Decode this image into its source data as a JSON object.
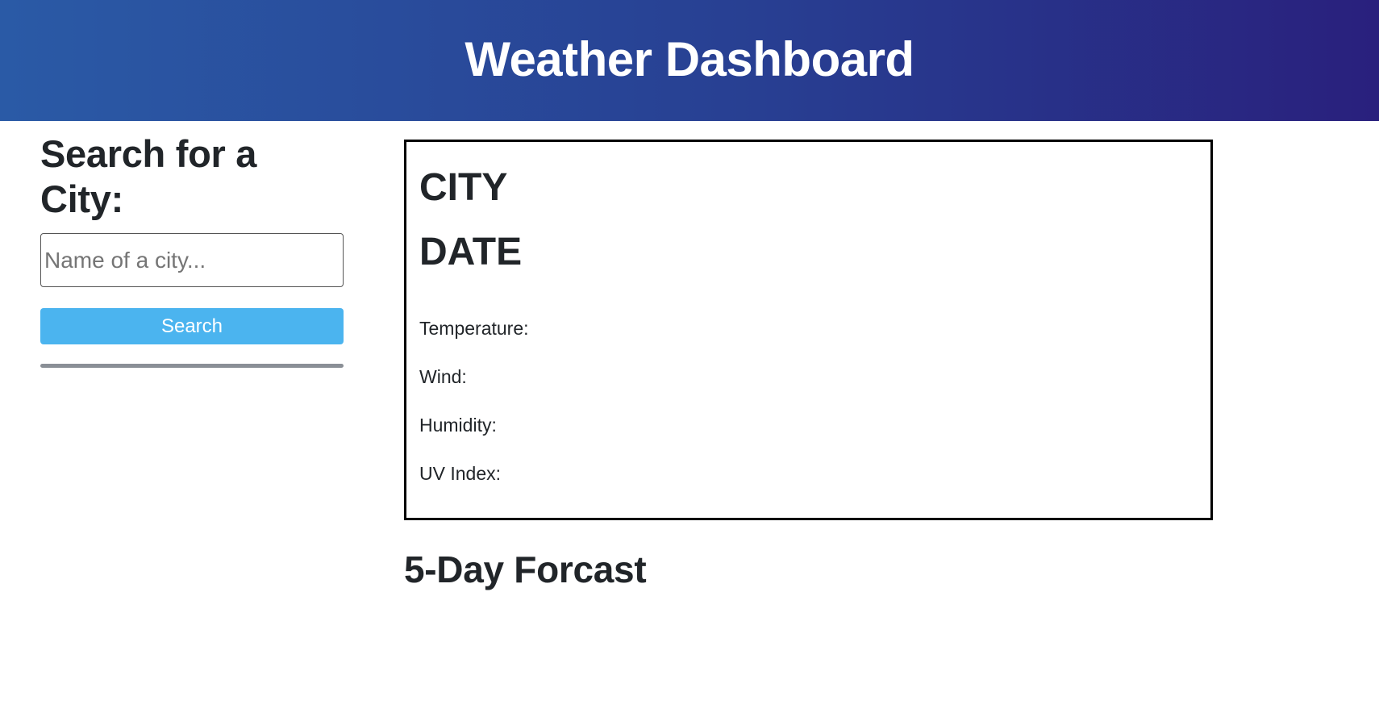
{
  "header": {
    "title": "Weather Dashboard",
    "gradient_start": "#2a5aa6",
    "gradient_end": "#29207d"
  },
  "sidebar": {
    "heading": "Search for a City:",
    "search": {
      "placeholder": "Name of a city...",
      "value": ""
    },
    "search_button_label": "Search",
    "button_color": "#4bb4ef"
  },
  "current_weather": {
    "city": "CITY",
    "date": "DATE",
    "temperature_label": "Temperature:",
    "wind_label": "Wind:",
    "humidity_label": "Humidity:",
    "uv_index_label": "UV Index:"
  },
  "forecast": {
    "heading": "5-Day Forcast"
  }
}
